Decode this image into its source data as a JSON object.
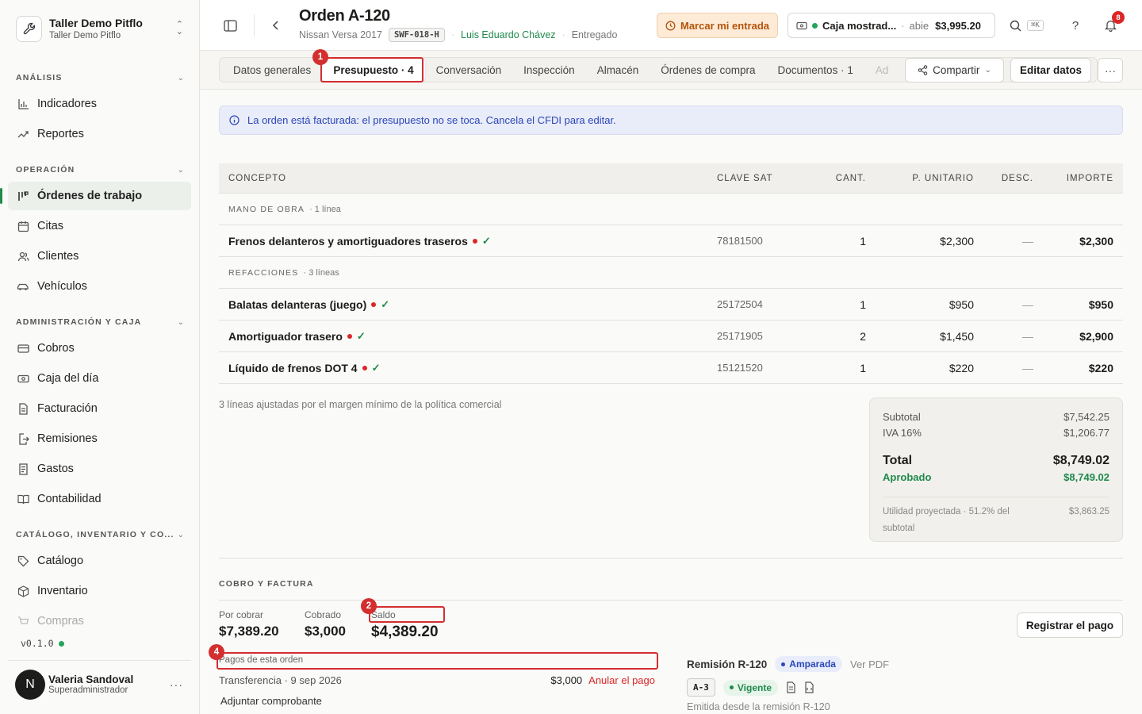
{
  "workspace": {
    "name": "Taller Demo Pitflo",
    "sub": "Taller Demo Pitflo"
  },
  "sidebar": {
    "sections": [
      {
        "label": "ANÁLISIS"
      },
      {
        "label": "OPERACIÓN"
      },
      {
        "label": "ADMINISTRACIÓN Y CAJA"
      },
      {
        "label": "CATÁLOGO, INVENTARIO Y CO..."
      }
    ],
    "items": [
      {
        "label": "Indicadores",
        "icon": "bar-chart-icon"
      },
      {
        "label": "Reportes",
        "icon": "trend-icon"
      },
      {
        "label": "Órdenes de trabajo",
        "icon": "kanban-icon",
        "active": true
      },
      {
        "label": "Citas",
        "icon": "calendar-icon"
      },
      {
        "label": "Clientes",
        "icon": "users-icon"
      },
      {
        "label": "Vehículos",
        "icon": "car-icon"
      },
      {
        "label": "Cobros",
        "icon": "card-icon"
      },
      {
        "label": "Caja del día",
        "icon": "cash-icon"
      },
      {
        "label": "Facturación",
        "icon": "invoice-icon"
      },
      {
        "label": "Remisiones",
        "icon": "export-icon"
      },
      {
        "label": "Gastos",
        "icon": "receipt-icon"
      },
      {
        "label": "Contabilidad",
        "icon": "book-icon"
      },
      {
        "label": "Catálogo",
        "icon": "tag-icon"
      },
      {
        "label": "Inventario",
        "icon": "box-icon"
      },
      {
        "label": "Compras",
        "icon": "cart-icon"
      }
    ],
    "version": "v0.1.0",
    "user": {
      "initial": "N",
      "name": "Valeria Sandoval",
      "role": "Superadministrador"
    }
  },
  "header": {
    "title": "Orden A-120",
    "vehicle": "Nissan Versa 2017",
    "plate": "SWF-018-H",
    "customer": "Luis Eduardo Chávez",
    "status": "Entregado",
    "check_in": "Marcar mi entrada",
    "caja_name": "Caja mostrad...",
    "caja_state": "abie",
    "caja_amount": "$3,995.20",
    "kbd": "⌘K",
    "help": "?",
    "notifications": "8"
  },
  "tabs": [
    {
      "label": "Datos generales"
    },
    {
      "label": "Presupuesto · 4",
      "active": true
    },
    {
      "label": "Conversación"
    },
    {
      "label": "Inspección"
    },
    {
      "label": "Almacén"
    },
    {
      "label": "Órdenes de compra"
    },
    {
      "label": "Documentos · 1"
    },
    {
      "label": "Ad"
    }
  ],
  "actions": {
    "share": "Compartir",
    "edit": "Editar datos"
  },
  "info_banner": "La orden está facturada: el presupuesto no se toca. Cancela el CFDI para editar.",
  "table": {
    "headers": [
      "CONCEPTO",
      "CLAVE SAT",
      "CANT.",
      "P. UNITARIO",
      "DESC.",
      "IMPORTE"
    ],
    "groups": [
      {
        "label": "MANO DE OBRA",
        "count": "· 1 línea",
        "rows": [
          {
            "concept": "Frenos delanteros y amortiguadores traseros",
            "sat": "78181500",
            "qty": "1",
            "unit": "$2,300",
            "disc": "—",
            "amount": "$2,300"
          }
        ]
      },
      {
        "label": "REFACCIONES",
        "count": "· 3 líneas",
        "rows": [
          {
            "concept": "Balatas delanteras (juego)",
            "sat": "25172504",
            "qty": "1",
            "unit": "$950",
            "disc": "—",
            "amount": "$950"
          },
          {
            "concept": "Amortiguador trasero",
            "sat": "25171905",
            "qty": "2",
            "unit": "$1,450",
            "disc": "—",
            "amount": "$2,900"
          },
          {
            "concept": "Líquido de frenos DOT 4",
            "sat": "15121520",
            "qty": "1",
            "unit": "$220",
            "disc": "—",
            "amount": "$220"
          }
        ]
      }
    ]
  },
  "note": "3 líneas ajustadas por el margen mínimo de la política comercial",
  "totals": {
    "subtotal_label": "Subtotal",
    "subtotal": "$7,542.25",
    "iva_label": "IVA 16%",
    "iva": "$1,206.77",
    "total_label": "Total",
    "total": "$8,749.02",
    "approved_label": "Aprobado",
    "approved": "$8,749.02",
    "utility_label": "Utilidad proyectada · 51.2% del subtotal",
    "utility": "$3,863.25"
  },
  "cobro": {
    "heading": "COBRO Y FACTURA",
    "por_cobrar_label": "Por cobrar",
    "por_cobrar": "$7,389.20",
    "cobrado_label": "Cobrado",
    "cobrado": "$3,000",
    "saldo_label": "Saldo",
    "saldo": "$4,389.20",
    "register": "Registrar el pago",
    "payments_label": "Pagos de esta orden",
    "payment": {
      "desc": "Transferencia · 9 sep 2026",
      "amount": "$3,000",
      "cancel": "Anular el pago"
    },
    "attach": "Adjuntar comprobante",
    "remision": {
      "title": "Remisión R-120",
      "status": "Amparada",
      "pdf": "Ver PDF",
      "code": "A-3",
      "validity": "Vigente",
      "note": "Emitida desde la remisión R-120"
    }
  },
  "annotations": [
    "1",
    "2",
    "4"
  ],
  "colors": {
    "accent": "#1f8a4c",
    "danger": "#dc2626",
    "info": "#2a47b8",
    "annotation": "#d32f2f"
  }
}
